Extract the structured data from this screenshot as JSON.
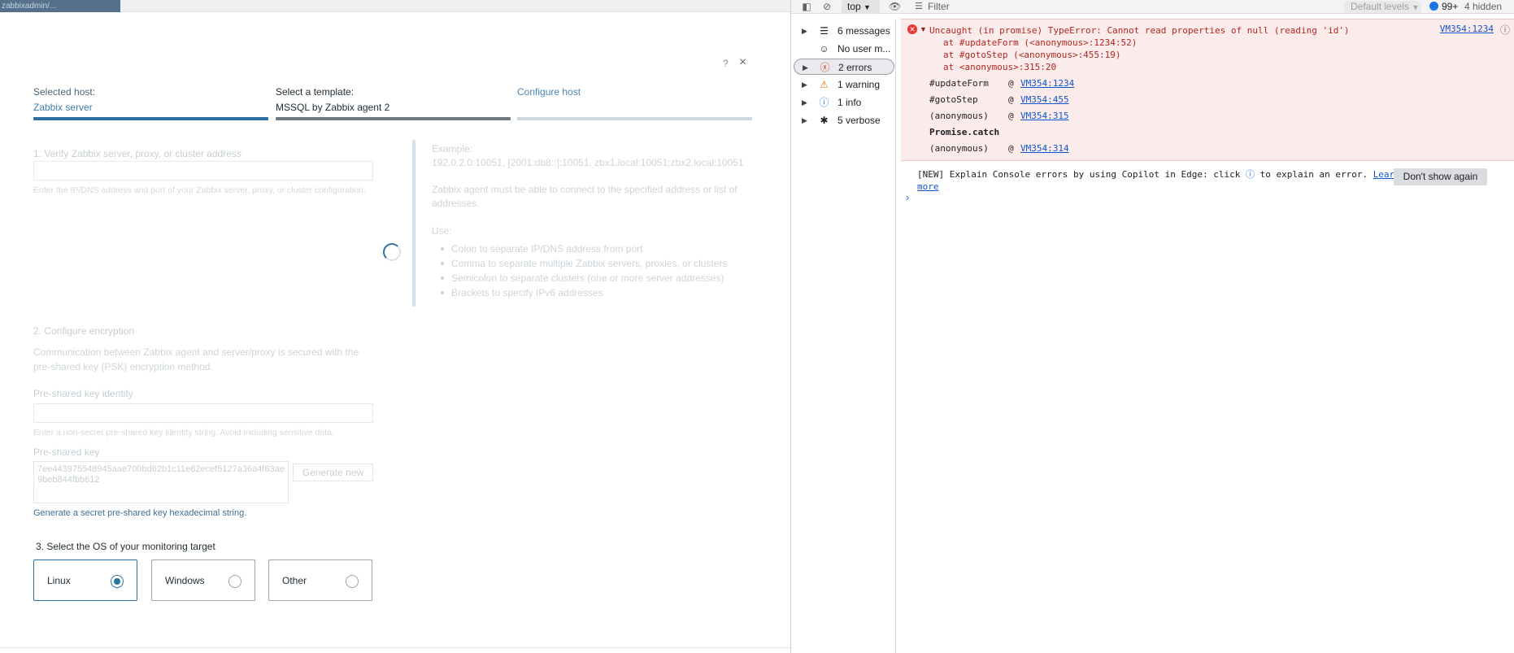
{
  "page": {
    "tab_text": "zabbixadmin/...",
    "help": "?",
    "close": "×",
    "steps": [
      {
        "label": "Selected host:",
        "value": "Zabbix server"
      },
      {
        "label": "Select a template:",
        "value": "MSSQL by Zabbix agent 2"
      },
      {
        "label": "",
        "value": "Configure host"
      }
    ],
    "section1": {
      "title": "1. Verify Zabbix server, proxy, or cluster address",
      "hint": "Enter the IP/DNS address and port of your Zabbix server, proxy, or cluster configuration.",
      "example_label": "Example:",
      "example_value": "192.0.2.0:10051, [2001:db8::]:10051, zbx1.local:10051;zbx2.local:10051",
      "info": "Zabbix agent must be able to connect to the specified address or list of addresses.",
      "use_label": "Use:",
      "use_items": [
        "Colon to separate IP/DNS address from port",
        "Comma to separate multiple Zabbix servers, proxies, or clusters",
        "Semicolon to separate clusters (one or more server addresses)",
        "Brackets to specify IPv6 addresses"
      ]
    },
    "section2": {
      "title": "2. Configure encryption",
      "desc": "Communication between Zabbix agent and server/proxy is secured with the pre-shared key (PSK) encryption method.",
      "psk_identity_label": "Pre-shared key identity",
      "psk_identity_hint": "Enter a non-secret pre-shared key identity string. Avoid including sensitive data.",
      "psk_label": "Pre-shared key",
      "psk_value": "7ee443975548945aae700bd62b1c11e82ecef5127a36a4f63ae9beb844fbb612",
      "generate_new": "Generate new",
      "generate_link": "Generate a secret pre-shared key hexadecimal string."
    },
    "section3": {
      "title": "3. Select the OS of your monitoring target",
      "options": [
        {
          "name": "Linux",
          "selected": true
        },
        {
          "name": "Windows",
          "selected": false
        },
        {
          "name": "Other",
          "selected": false
        }
      ]
    }
  },
  "devtools": {
    "context": "top",
    "filter_placeholder": "Filter",
    "levels": "Default levels",
    "issues_count": "99+",
    "hidden_count": "4 hidden",
    "sidebar": [
      {
        "icon": "list-icon",
        "label": "6 messages"
      },
      {
        "icon": "user-icon",
        "label": "No user m..."
      },
      {
        "icon": "error-icon",
        "label": "2 errors"
      },
      {
        "icon": "warning-icon",
        "label": "1 warning"
      },
      {
        "icon": "info-icon",
        "label": "1 info"
      },
      {
        "icon": "bug-icon",
        "label": "5 verbose"
      }
    ],
    "error": {
      "message": "Uncaught (in promise) TypeError: Cannot read properties of null (reading 'id')",
      "source": "VM354:1234",
      "trace": [
        "at #updateForm (<anonymous>:1234:52)",
        "at #gotoStep (<anonymous>:455:19)",
        "at <anonymous>:315:20"
      ],
      "stack": [
        {
          "fn": "#updateForm",
          "link": "VM354:1234"
        },
        {
          "fn": "#gotoStep",
          "link": "VM354:455"
        },
        {
          "fn": "(anonymous)",
          "link": "VM354:315"
        }
      ],
      "promise_catch": "Promise.catch",
      "last": {
        "fn": "(anonymous)",
        "link": "VM354:314"
      }
    },
    "copilot_text": "[NEW] Explain Console errors by using Copilot in Edge: click",
    "copilot_text2": "to explain an error.",
    "learn_more": "Learn more",
    "dont_show": "Don't show again",
    "prompt": "›"
  },
  "colors": {
    "accent": "#2d70a3",
    "error_bg": "#fcebeb",
    "error_text": "#b3261e"
  }
}
